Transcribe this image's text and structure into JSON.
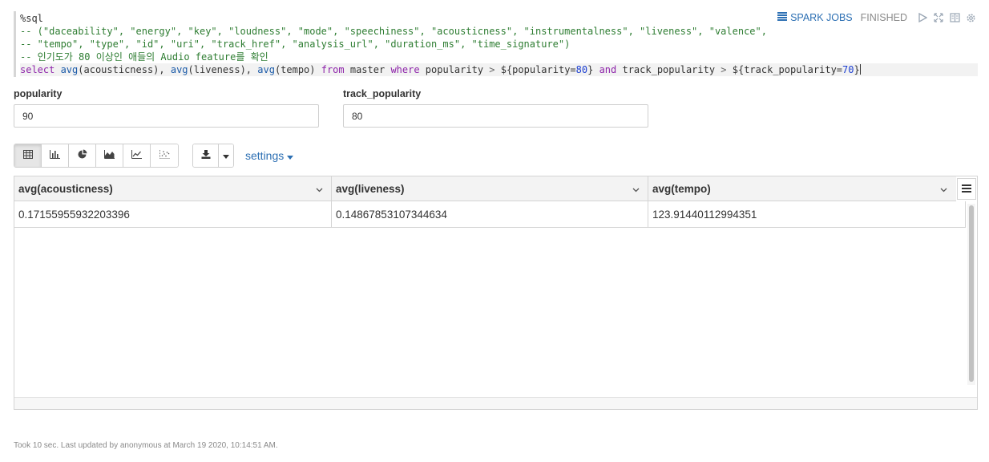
{
  "editor": {
    "lines": [
      [
        {
          "t": "%sql",
          "c": "c-plain"
        }
      ],
      [
        {
          "t": "-- (\"daceability\", \"energy\", \"key\", \"loudness\", \"mode\", \"speechiness\", \"acousticness\", \"instrumentalness\", \"liveness\", \"valence\",",
          "c": "c-comment"
        }
      ],
      [
        {
          "t": "-- \"tempo\", \"type\", \"id\", \"uri\", \"track_href\", \"analysis_url\", \"duration_ms\", \"time_signature\")",
          "c": "c-comment"
        }
      ],
      [
        {
          "t": "-- 인기도가 80 이상인 애들의 Audio feature를 확인",
          "c": "c-comment"
        }
      ],
      [
        {
          "t": "select ",
          "c": "c-kw"
        },
        {
          "t": "avg",
          "c": "c-fn"
        },
        {
          "t": "(acousticness), ",
          "c": "c-plain"
        },
        {
          "t": "avg",
          "c": "c-fn"
        },
        {
          "t": "(liveness), ",
          "c": "c-plain"
        },
        {
          "t": "avg",
          "c": "c-fn"
        },
        {
          "t": "(tempo) ",
          "c": "c-plain"
        },
        {
          "t": "from ",
          "c": "c-kw"
        },
        {
          "t": "master ",
          "c": "c-plain"
        },
        {
          "t": "where ",
          "c": "c-kw"
        },
        {
          "t": "popularity ",
          "c": "c-plain"
        },
        {
          "t": "> ",
          "c": "c-op"
        },
        {
          "t": "${popularity=",
          "c": "c-plain"
        },
        {
          "t": "80",
          "c": "c-num"
        },
        {
          "t": "} ",
          "c": "c-plain"
        },
        {
          "t": "and ",
          "c": "c-kw"
        },
        {
          "t": "track_popularity ",
          "c": "c-plain"
        },
        {
          "t": "> ",
          "c": "c-op"
        },
        {
          "t": "${track_popularity=",
          "c": "c-plain"
        },
        {
          "t": "70",
          "c": "c-num"
        },
        {
          "t": "}",
          "c": "c-plain"
        }
      ]
    ]
  },
  "paragraph": {
    "spark_jobs_label": "SPARK JOBS",
    "status": "FINISHED",
    "icons": [
      "run-icon",
      "expand-icon",
      "book-icon",
      "gear-icon"
    ]
  },
  "forms": {
    "popularity": {
      "label": "popularity",
      "value": "90"
    },
    "track_popularity": {
      "label": "track_popularity",
      "value": "80"
    }
  },
  "toolbar": {
    "viz_buttons": [
      "table-icon",
      "bar-chart-icon",
      "pie-chart-icon",
      "area-chart-icon",
      "line-chart-icon",
      "scatter-chart-icon"
    ],
    "active_viz": "table-icon",
    "settings_label": "settings"
  },
  "grid": {
    "columns": [
      "avg(acousticness)",
      "avg(liveness)",
      "avg(tempo)"
    ],
    "rows": [
      [
        "0.17155955932203396",
        "0.14867853107344634",
        "123.91440112994351"
      ]
    ]
  },
  "footer": {
    "text": "Took 10 sec. Last updated by anonymous at March 19 2020, 10:14:51 AM."
  },
  "colors": {
    "link": "#2c6fb3",
    "comment": "#2e7d32",
    "keyword": "#8e24aa"
  }
}
